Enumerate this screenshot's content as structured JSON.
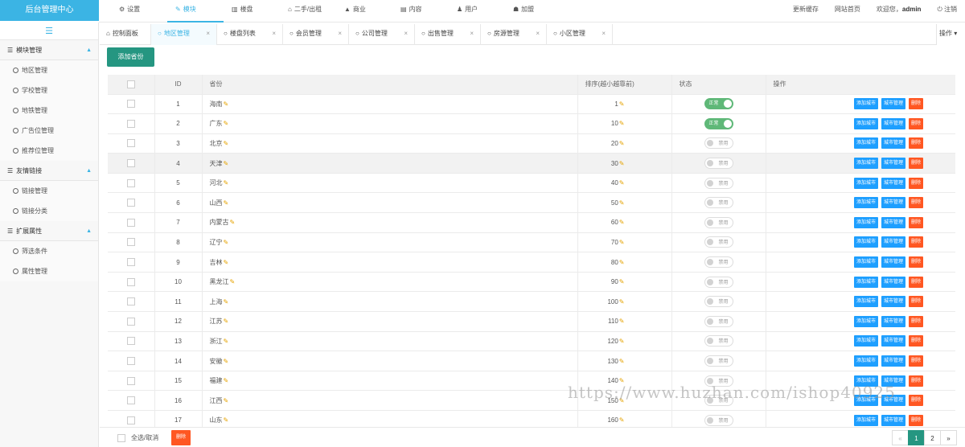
{
  "app": {
    "title": "后台管理中心"
  },
  "topnav": [
    {
      "icon": "⚙",
      "label": "设置"
    },
    {
      "icon": "✎",
      "label": "模块",
      "active": true
    },
    {
      "icon": "▥",
      "label": "楼盘"
    },
    {
      "icon": "⌂",
      "label": "二手/出租"
    },
    {
      "icon": "▲",
      "label": "商业"
    },
    {
      "icon": "▤",
      "label": "内容"
    },
    {
      "icon": "♟",
      "label": "用户"
    },
    {
      "icon": "☗",
      "label": "加盟"
    }
  ],
  "topright": {
    "update": "更新缓存",
    "home": "网站首页",
    "welcome": "欢迎您，",
    "user": "admin",
    "logout_icon": "⏻",
    "logout": "注销"
  },
  "sidebar": {
    "toggle": "☰",
    "groups": [
      {
        "title": "模块管理",
        "items": [
          "地区管理",
          "学校管理",
          "地铁管理",
          "广告位管理",
          "推荐位管理"
        ]
      },
      {
        "title": "友情链接",
        "items": [
          "链接管理",
          "链接分类"
        ]
      },
      {
        "title": "扩展属性",
        "items": [
          "筛选条件",
          "属性管理"
        ]
      }
    ]
  },
  "tabs": [
    {
      "label": "控制面板",
      "icon": "⌂",
      "closable": false
    },
    {
      "label": "地区管理",
      "icon": "○",
      "closable": true,
      "active": true
    },
    {
      "label": "楼盘列表",
      "icon": "○",
      "closable": true
    },
    {
      "label": "会员管理",
      "icon": "○",
      "closable": true
    },
    {
      "label": "公司管理",
      "icon": "○",
      "closable": true
    },
    {
      "label": "出售管理",
      "icon": "○",
      "closable": true
    },
    {
      "label": "房源管理",
      "icon": "○",
      "closable": true
    },
    {
      "label": "小区管理",
      "icon": "○",
      "closable": true
    }
  ],
  "tab_ops": "操作",
  "toolbar": {
    "add_province": "添加省份"
  },
  "table": {
    "headers": {
      "id": "ID",
      "province": "省份",
      "sort": "排序(越小越靠前)",
      "status": "状态",
      "ops": "操作"
    },
    "status_on": "正常",
    "status_off": "禁用",
    "btn_add_city": "添加城市",
    "btn_city_manage": "城市管理",
    "btn_delete": "删除",
    "rows": [
      {
        "id": "1",
        "name": "海南",
        "sort": "1",
        "on": true
      },
      {
        "id": "2",
        "name": "广东",
        "sort": "10",
        "on": true
      },
      {
        "id": "3",
        "name": "北京",
        "sort": "20",
        "on": false
      },
      {
        "id": "4",
        "name": "天津",
        "sort": "30",
        "on": false
      },
      {
        "id": "5",
        "name": "河北",
        "sort": "40",
        "on": false
      },
      {
        "id": "6",
        "name": "山西",
        "sort": "50",
        "on": false
      },
      {
        "id": "7",
        "name": "内蒙古",
        "sort": "60",
        "on": false
      },
      {
        "id": "8",
        "name": "辽宁",
        "sort": "70",
        "on": false
      },
      {
        "id": "9",
        "name": "吉林",
        "sort": "80",
        "on": false
      },
      {
        "id": "10",
        "name": "黑龙江",
        "sort": "90",
        "on": false
      },
      {
        "id": "11",
        "name": "上海",
        "sort": "100",
        "on": false
      },
      {
        "id": "12",
        "name": "江苏",
        "sort": "110",
        "on": false
      },
      {
        "id": "13",
        "name": "浙江",
        "sort": "120",
        "on": false
      },
      {
        "id": "14",
        "name": "安徽",
        "sort": "130",
        "on": false
      },
      {
        "id": "15",
        "name": "福建",
        "sort": "140",
        "on": false
      },
      {
        "id": "16",
        "name": "江西",
        "sort": "150",
        "on": false
      },
      {
        "id": "17",
        "name": "山东",
        "sort": "160",
        "on": false
      }
    ]
  },
  "footer": {
    "select_all": "全选/取消",
    "delete": "删除"
  },
  "pager": {
    "prev": "«",
    "pages": [
      "1",
      "2"
    ],
    "current": "1",
    "next": "»"
  },
  "watermark": "https://www.huzhan.com/ishop40925"
}
